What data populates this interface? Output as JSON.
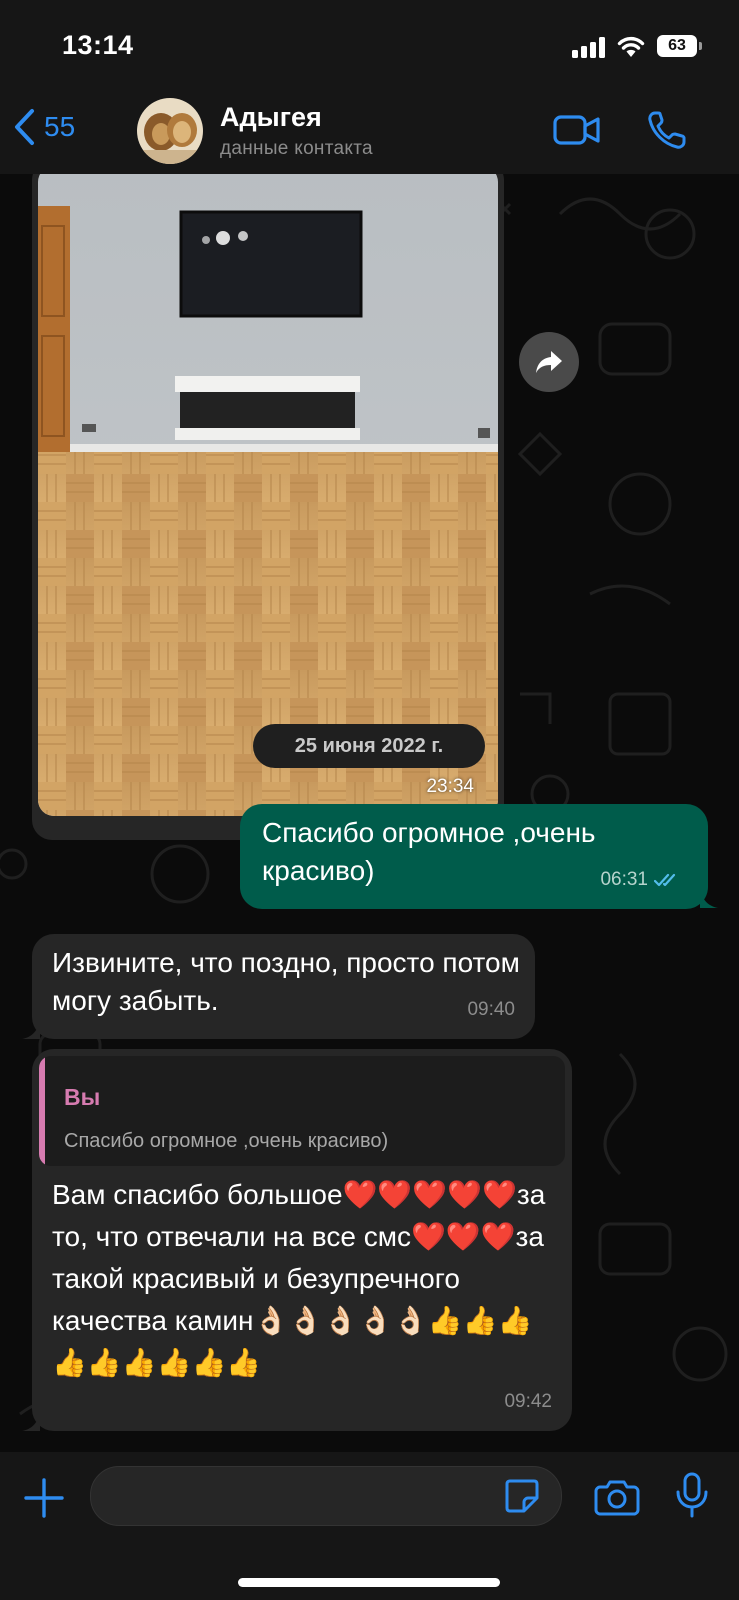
{
  "status_bar": {
    "time": "13:14",
    "battery": "63"
  },
  "header": {
    "back_count": "55",
    "contact_name": "Адыгея",
    "contact_subtitle": "данные контакта"
  },
  "chat": {
    "photo_message": {
      "time": "23:34"
    },
    "date_separator": "25 июня 2022 г.",
    "messages": [
      {
        "direction": "out",
        "text": "Спасибо огромное ,очень красиво)",
        "time": "06:31",
        "status": "read"
      },
      {
        "direction": "in",
        "text": "Извините, что поздно, просто потом могу забыть.",
        "time": "09:40"
      },
      {
        "direction": "in",
        "quote": {
          "author": "Вы",
          "text": "Спасибо огромное ,очень красиво)"
        },
        "text": "Вам спасибо большое❤️❤️❤️❤️❤️за то, что отвечали на все смс❤️❤️❤️за такой красивый и безупречного качества камин👌🏻👌🏻👌🏻👌🏻👌🏻👍👍👍👍👍👍👍👍👍",
        "time": "09:42"
      }
    ]
  },
  "colors": {
    "accent": "#2e8cf0",
    "outgoing_bubble": "#005c4b",
    "incoming_bubble": "#262626",
    "quote_author": "#d67bb0"
  },
  "icons": {
    "back": "chevron-left-icon",
    "video_call": "video-camera-icon",
    "voice_call": "phone-icon",
    "forward": "forward-arrow-icon",
    "attach": "plus-icon",
    "sticker": "sticker-icon",
    "camera": "camera-icon",
    "microphone": "microphone-icon"
  }
}
